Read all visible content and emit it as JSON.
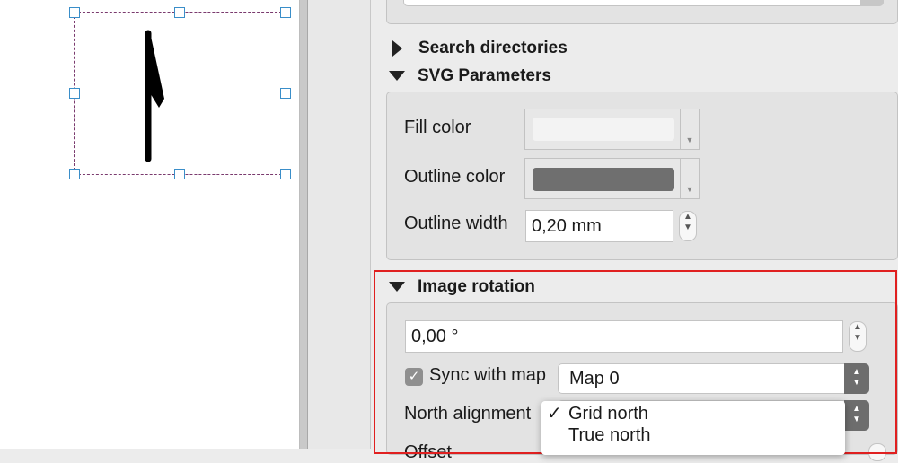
{
  "panel": {
    "search_directories": "Search directories",
    "svg_parameters": "SVG Parameters",
    "fill_color_label": "Fill color",
    "outline_color_label": "Outline color",
    "outline_width_label": "Outline width",
    "outline_width_value": "0,20 mm",
    "fill_color": "#f3f3f3",
    "outline_color": "#6f6f6f",
    "image_rotation": "Image rotation",
    "rotation_value": "0,00 °",
    "sync_label": "Sync with map",
    "sync_checked": true,
    "map_value": "Map 0",
    "north_alignment_label": "North alignment",
    "offset_label_partial": "Offset"
  },
  "dropdown": {
    "items": [
      {
        "label": "Grid north",
        "checked": true
      },
      {
        "label": "True north",
        "checked": false
      }
    ]
  },
  "colors": {
    "highlight": "#e02020",
    "selection_handle": "#3a8ec9"
  }
}
